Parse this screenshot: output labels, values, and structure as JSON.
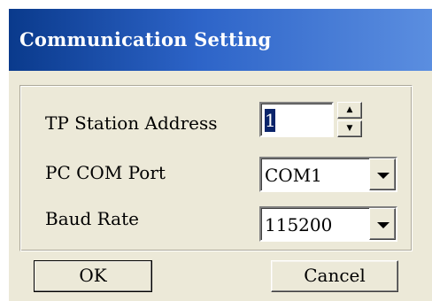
{
  "window": {
    "title": "Communication Setting"
  },
  "fields": {
    "station_address": {
      "label": "TP Station Address",
      "value": "1"
    },
    "com_port": {
      "label": "PC COM Port",
      "value": "COM1"
    },
    "baud_rate": {
      "label": "Baud Rate",
      "value": "115200"
    }
  },
  "buttons": {
    "ok_label": "OK",
    "cancel_label": "Cancel"
  },
  "icons": {
    "spin_up": "spin-up-icon",
    "spin_down": "spin-down-icon",
    "dropdown": "chevron-down-icon"
  },
  "colors": {
    "titlebar": "#0a3a8c",
    "dialog_face": "#ece9d8",
    "selection": "#0a246a"
  }
}
